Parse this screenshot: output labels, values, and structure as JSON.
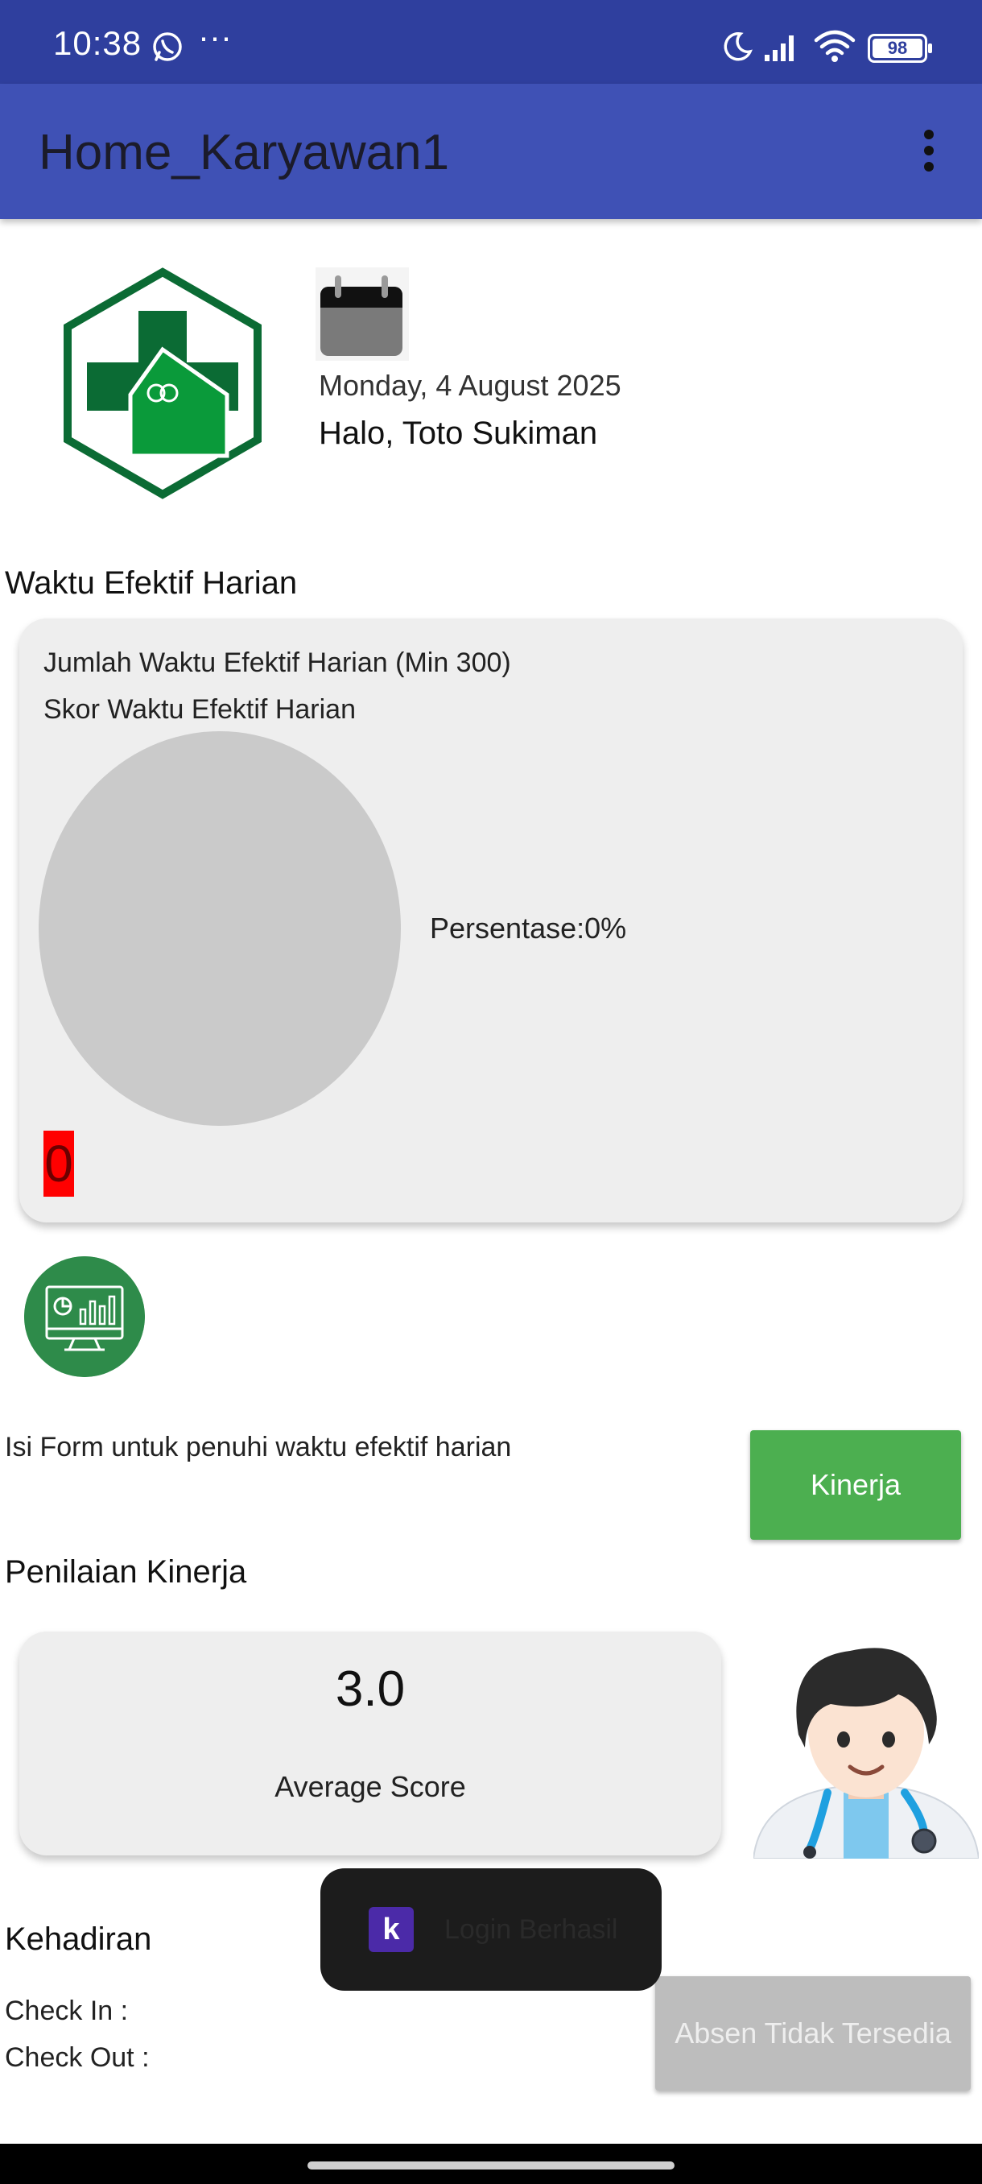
{
  "status_bar": {
    "time": "10:38",
    "more": "···",
    "battery": "98"
  },
  "app_bar": {
    "title": "Home_Karyawan1"
  },
  "header": {
    "date": "Monday, 4 August 2025",
    "greeting": "Halo, Toto Sukiman"
  },
  "waktu_efektif": {
    "section_title": "Waktu Efektif Harian",
    "jumlah_label": "Jumlah Waktu Efektif Harian (Min 300)",
    "skor_label": "Skor Waktu Efektif Harian",
    "persentase": "Persentase:0%",
    "count": "0"
  },
  "form_prompt": {
    "text": "Isi Form untuk penuhi waktu efektif harian",
    "button_label": "Kinerja"
  },
  "penilaian": {
    "section_title": "Penilaian Kinerja",
    "score": "3.0",
    "score_label": "Average Score"
  },
  "kehadiran": {
    "section_title": "Kehadiran",
    "check_in": "Check In :",
    "check_out": "Check Out :",
    "button_label": "Absen Tidak Tersedia"
  },
  "toast": {
    "icon_letter": "k",
    "message": "Login Berhasil"
  },
  "colors": {
    "app_bar": "#3f51b5",
    "status_bar": "#2f3f9e",
    "kinerja_button": "#4caf50",
    "absen_button": "#bdbdbd",
    "logo_green": "#0b6b34"
  }
}
